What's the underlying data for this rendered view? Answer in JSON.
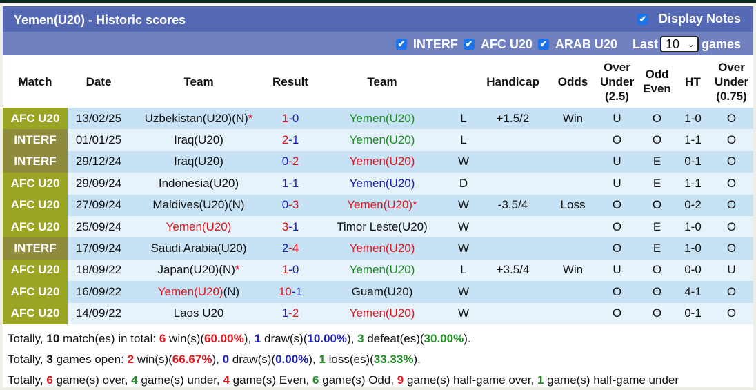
{
  "header": {
    "title": "Yemen(U20) - Historic scores",
    "display_notes_label": "Display Notes",
    "display_notes_checked": true
  },
  "filters": {
    "items": [
      {
        "label": "INTERF",
        "checked": true
      },
      {
        "label": "AFC U20",
        "checked": true
      },
      {
        "label": "ARAB U20",
        "checked": true
      }
    ],
    "last_label": "Last",
    "last_value": "10",
    "games_label": "games"
  },
  "table": {
    "columns": [
      "Match",
      "Date",
      "Team",
      "Result",
      "Team",
      "",
      "Handicap",
      "Odds",
      "Over Under (2.5)",
      "Odd Even",
      "HT",
      "Over Under (0.75)"
    ],
    "column_lines": {
      "ou25": [
        "Over",
        "Under",
        "(2.5)"
      ],
      "oddeven": [
        "Odd",
        "Even"
      ],
      "ou075": [
        "Over",
        "Under",
        "(0.75)"
      ]
    },
    "rows": [
      {
        "league": "AFC U20",
        "league_type": "afc",
        "date": "13/02/25",
        "home": "Uzbekistan(U20)(N)",
        "home_star": "*",
        "home_color": "black",
        "score_home": "1",
        "score_home_color": "red",
        "score_away": "0",
        "score_away_color": "blue",
        "away": "Yemen(U20)",
        "away_star": "",
        "away_color": "green",
        "wl": "L",
        "wl_color": "green",
        "handicap": "+1.5/2",
        "odds": "Win",
        "odds_color": "red",
        "ou": "U",
        "ou_color": "green",
        "oe": "O",
        "oe_color": "green",
        "ht": "1-0",
        "ou2": "O",
        "ou2_color": "red"
      },
      {
        "league": "INTERF",
        "league_type": "interf",
        "date": "01/01/25",
        "home": "Iraq(U20)",
        "home_star": "",
        "home_color": "black",
        "score_home": "2",
        "score_home_color": "red",
        "score_away": "1",
        "score_away_color": "blue",
        "away": "Yemen(U20)",
        "away_star": "",
        "away_color": "green",
        "wl": "L",
        "wl_color": "green",
        "handicap": "",
        "odds": "",
        "odds_color": "red",
        "ou": "O",
        "ou_color": "red",
        "oe": "O",
        "oe_color": "green",
        "ht": "1-1",
        "ou2": "O",
        "ou2_color": "red"
      },
      {
        "league": "INTERF",
        "league_type": "interf",
        "date": "29/12/24",
        "home": "Iraq(U20)",
        "home_star": "",
        "home_color": "black",
        "score_home": "0",
        "score_home_color": "blue",
        "score_away": "2",
        "score_away_color": "red",
        "away": "Yemen(U20)",
        "away_star": "",
        "away_color": "red",
        "wl": "W",
        "wl_color": "red",
        "handicap": "",
        "odds": "",
        "odds_color": "red",
        "ou": "U",
        "ou_color": "green",
        "oe": "E",
        "oe_color": "red",
        "ht": "0-1",
        "ou2": "O",
        "ou2_color": "red"
      },
      {
        "league": "AFC U20",
        "league_type": "afc",
        "date": "29/09/24",
        "home": "Indonesia(U20)",
        "home_star": "",
        "home_color": "black",
        "score_home": "1",
        "score_home_color": "blue",
        "score_away": "1",
        "score_away_color": "blue",
        "away": "Yemen(U20)",
        "away_star": "",
        "away_color": "blue",
        "wl": "D",
        "wl_color": "blue",
        "handicap": "",
        "odds": "",
        "odds_color": "red",
        "ou": "U",
        "ou_color": "green",
        "oe": "E",
        "oe_color": "red",
        "ht": "1-1",
        "ou2": "O",
        "ou2_color": "red"
      },
      {
        "league": "AFC U20",
        "league_type": "afc",
        "date": "27/09/24",
        "home": "Maldives(U20)(N)",
        "home_star": "",
        "home_color": "black",
        "score_home": "0",
        "score_home_color": "blue",
        "score_away": "3",
        "score_away_color": "red",
        "away": "Yemen(U20)",
        "away_star": "*",
        "away_color": "red",
        "wl": "W",
        "wl_color": "red",
        "handicap": "-3.5/4",
        "odds": "Loss",
        "odds_color": "green",
        "ou": "O",
        "ou_color": "red",
        "oe": "O",
        "oe_color": "green",
        "ht": "0-2",
        "ou2": "O",
        "ou2_color": "red"
      },
      {
        "league": "AFC U20",
        "league_type": "afc",
        "date": "25/09/24",
        "home": "Yemen(U20)",
        "home_star": "",
        "home_color": "red",
        "score_home": "3",
        "score_home_color": "red",
        "score_away": "1",
        "score_away_color": "blue",
        "away": "Timor Leste(U20)",
        "away_star": "",
        "away_color": "black",
        "wl": "W",
        "wl_color": "red",
        "handicap": "",
        "odds": "",
        "odds_color": "red",
        "ou": "O",
        "ou_color": "red",
        "oe": "E",
        "oe_color": "red",
        "ht": "1-0",
        "ou2": "O",
        "ou2_color": "red"
      },
      {
        "league": "INTERF",
        "league_type": "interf",
        "date": "17/09/24",
        "home": "Saudi Arabia(U20)",
        "home_star": "",
        "home_color": "black",
        "score_home": "2",
        "score_home_color": "blue",
        "score_away": "4",
        "score_away_color": "red",
        "away": "Yemen(U20)",
        "away_star": "",
        "away_color": "red",
        "wl": "W",
        "wl_color": "red",
        "handicap": "",
        "odds": "",
        "odds_color": "red",
        "ou": "O",
        "ou_color": "red",
        "oe": "E",
        "oe_color": "red",
        "ht": "1-0",
        "ou2": "O",
        "ou2_color": "red"
      },
      {
        "league": "AFC U20",
        "league_type": "afc",
        "date": "18/09/22",
        "home": "Japan(U20)(N)",
        "home_star": "*",
        "home_color": "black",
        "score_home": "1",
        "score_home_color": "red",
        "score_away": "0",
        "score_away_color": "blue",
        "away": "Yemen(U20)",
        "away_star": "",
        "away_color": "green",
        "wl": "L",
        "wl_color": "green",
        "handicap": "+3.5/4",
        "odds": "Win",
        "odds_color": "red",
        "ou": "U",
        "ou_color": "green",
        "oe": "O",
        "oe_color": "green",
        "ht": "0-0",
        "ou2": "U",
        "ou2_color": "green"
      },
      {
        "league": "AFC U20",
        "league_type": "afc",
        "date": "16/09/22",
        "home": "Yemen(U20)",
        "home_suffix": "(N)",
        "home_star": "",
        "home_color": "red",
        "score_home": "10",
        "score_home_color": "red",
        "score_away": "1",
        "score_away_color": "blue",
        "away": "Guam(U20)",
        "away_star": "",
        "away_color": "black",
        "wl": "W",
        "wl_color": "red",
        "handicap": "",
        "odds": "",
        "odds_color": "red",
        "ou": "O",
        "ou_color": "red",
        "oe": "O",
        "oe_color": "green",
        "ht": "4-1",
        "ou2": "O",
        "ou2_color": "red"
      },
      {
        "league": "AFC U20",
        "league_type": "afc",
        "date": "14/09/22",
        "home": "Laos U20",
        "home_star": "",
        "home_color": "black",
        "score_home": "1",
        "score_home_color": "blue",
        "score_away": "2",
        "score_away_color": "red",
        "away": "Yemen(U20)",
        "away_star": "",
        "away_color": "red",
        "wl": "W",
        "wl_color": "red",
        "handicap": "",
        "odds": "",
        "odds_color": "red",
        "ou": "O",
        "ou_color": "red",
        "oe": "O",
        "oe_color": "green",
        "ht": "0-1",
        "ou2": "O",
        "ou2_color": "red"
      }
    ]
  },
  "summary": {
    "line1": [
      {
        "t": "Totally, ",
        "c": "black",
        "b": false
      },
      {
        "t": "10",
        "c": "black",
        "b": true
      },
      {
        "t": " match(es) in total: ",
        "c": "black",
        "b": false
      },
      {
        "t": "6",
        "c": "red",
        "b": true
      },
      {
        "t": " win(s)(",
        "c": "black",
        "b": false
      },
      {
        "t": "60.00%",
        "c": "red",
        "b": true
      },
      {
        "t": "), ",
        "c": "black",
        "b": false
      },
      {
        "t": "1",
        "c": "blue",
        "b": true
      },
      {
        "t": " draw(s)(",
        "c": "black",
        "b": false
      },
      {
        "t": "10.00%",
        "c": "blue",
        "b": true
      },
      {
        "t": "), ",
        "c": "black",
        "b": false
      },
      {
        "t": "3",
        "c": "green",
        "b": true
      },
      {
        "t": " defeat(es)(",
        "c": "black",
        "b": false
      },
      {
        "t": "30.00%",
        "c": "green",
        "b": true
      },
      {
        "t": ").",
        "c": "black",
        "b": false
      }
    ],
    "line2": [
      {
        "t": "Totally, ",
        "c": "black",
        "b": false
      },
      {
        "t": "3",
        "c": "black",
        "b": true
      },
      {
        "t": " games open: ",
        "c": "black",
        "b": false
      },
      {
        "t": "2",
        "c": "red",
        "b": true
      },
      {
        "t": " win(s)(",
        "c": "black",
        "b": false
      },
      {
        "t": "66.67%",
        "c": "red",
        "b": true
      },
      {
        "t": "), ",
        "c": "black",
        "b": false
      },
      {
        "t": "0",
        "c": "blue",
        "b": true
      },
      {
        "t": " draw(s)(",
        "c": "black",
        "b": false
      },
      {
        "t": "0.00%",
        "c": "blue",
        "b": true
      },
      {
        "t": "), ",
        "c": "black",
        "b": false
      },
      {
        "t": "1",
        "c": "green",
        "b": true
      },
      {
        "t": " loss(es)(",
        "c": "black",
        "b": false
      },
      {
        "t": "33.33%",
        "c": "green",
        "b": true
      },
      {
        "t": ").",
        "c": "black",
        "b": false
      }
    ],
    "line3": [
      {
        "t": "Totally, ",
        "c": "black",
        "b": false
      },
      {
        "t": "6",
        "c": "red",
        "b": true
      },
      {
        "t": " game(s) over, ",
        "c": "black",
        "b": false
      },
      {
        "t": "4",
        "c": "green",
        "b": true
      },
      {
        "t": " game(s) under, ",
        "c": "black",
        "b": false
      },
      {
        "t": "4",
        "c": "red",
        "b": true
      },
      {
        "t": " game(s) Even, ",
        "c": "black",
        "b": false
      },
      {
        "t": "6",
        "c": "green",
        "b": true
      },
      {
        "t": " game(s) Odd, ",
        "c": "black",
        "b": false
      },
      {
        "t": "9",
        "c": "red",
        "b": true
      },
      {
        "t": " game(s) half-game over, ",
        "c": "black",
        "b": false
      },
      {
        "t": "1",
        "c": "green",
        "b": true
      },
      {
        "t": " game(s) half-game under",
        "c": "black",
        "b": false
      }
    ]
  },
  "colors": {
    "title_bar": "#5568b3",
    "filter_bar": "#7180bf",
    "afc_league": "#9aa623",
    "interf_league": "#8f8b3d",
    "row_dark": "#c7e1f5",
    "row_light": "#e6f3fb",
    "red": "#e3161d",
    "blue": "#1f22b8",
    "green": "#1d8c22"
  }
}
